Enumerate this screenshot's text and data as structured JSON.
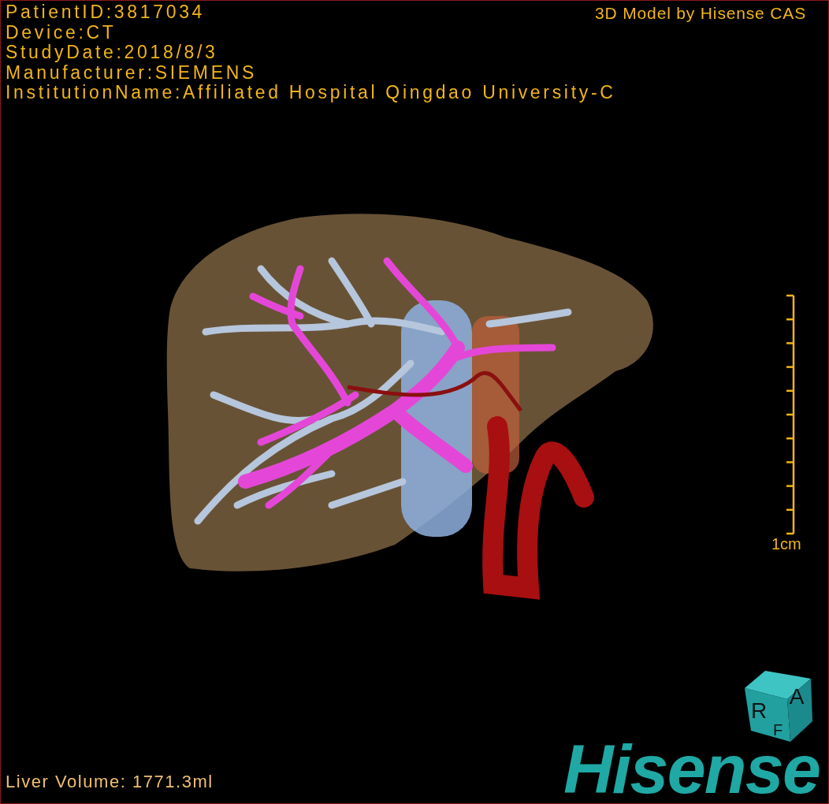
{
  "info_lines": [
    "PatientID:3817034",
    "Device:CT",
    "StudyDate:2018/8/3",
    "Manufacturer:SIEMENS",
    "InstitutionName:Affiliated Hospital Qingdao University-C"
  ],
  "title": "3D Model by Hisense CAS",
  "scale": {
    "label": "1cm"
  },
  "orientation_cube": {
    "faces": [
      "R",
      "A",
      "F"
    ]
  },
  "liver_volume": "Liver Volume: 1771.3ml",
  "logo": "Hisense"
}
